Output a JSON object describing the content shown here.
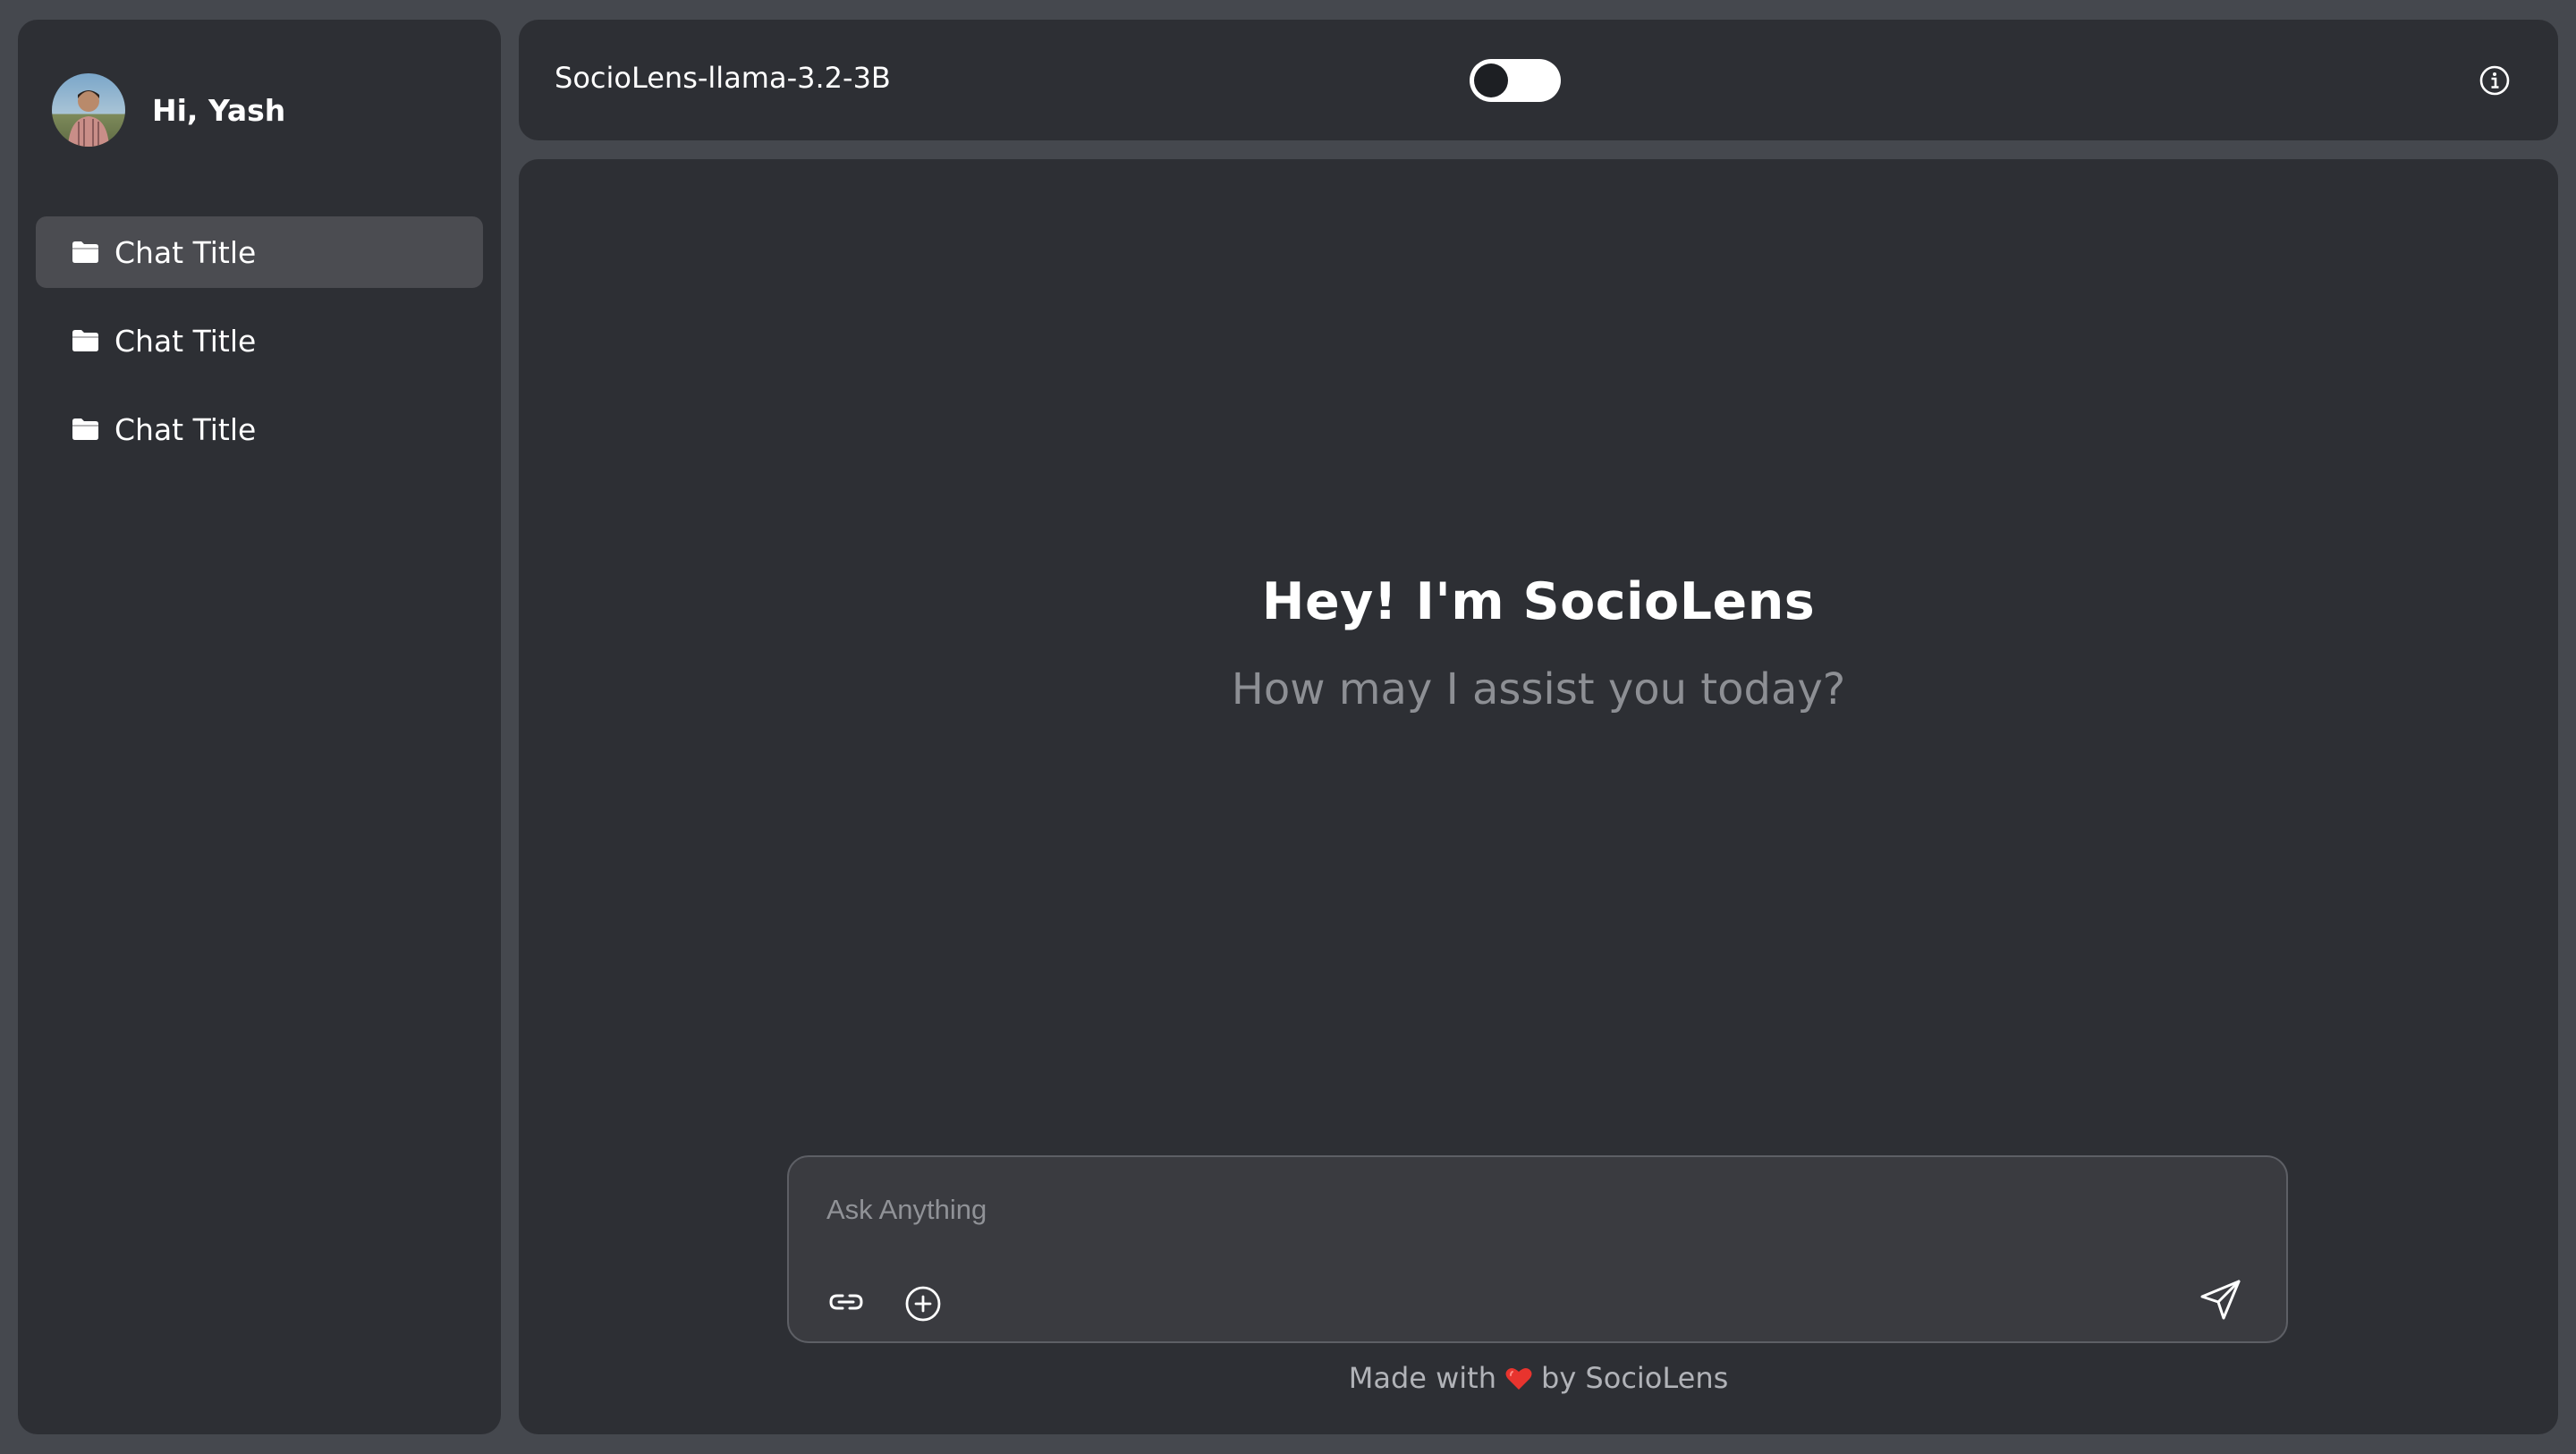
{
  "sidebar": {
    "greeting": "Hi, Yash",
    "avatar_icon": "user-avatar",
    "chats": [
      {
        "label": "Chat Title",
        "icon": "folder-icon",
        "active": true
      },
      {
        "label": "Chat Title",
        "icon": "folder-icon",
        "active": false
      },
      {
        "label": "Chat Title",
        "icon": "folder-icon",
        "active": false
      }
    ]
  },
  "header": {
    "model_name": "SocioLens-llama-3.2-3B",
    "toggle_icon": "theme-toggle",
    "toggle_on": false,
    "info_icon": "info-icon"
  },
  "hero": {
    "title": "Hey! I'm SocioLens",
    "subtitle": "How may I assist you today?"
  },
  "composer": {
    "placeholder": "Ask Anything",
    "value": "",
    "attach_icon": "link-icon",
    "add_icon": "plus-circle-icon",
    "send_icon": "send-icon"
  },
  "footer": {
    "prefix": "Made with",
    "heart_icon": "heart-icon",
    "suffix": "by SocioLens"
  },
  "colors": {
    "page_bg": "#45484e",
    "panel_bg": "#2d2f34",
    "active_item_bg": "#4b4c51",
    "composer_bg": "#3a3b40",
    "heart": "#e8342e"
  }
}
